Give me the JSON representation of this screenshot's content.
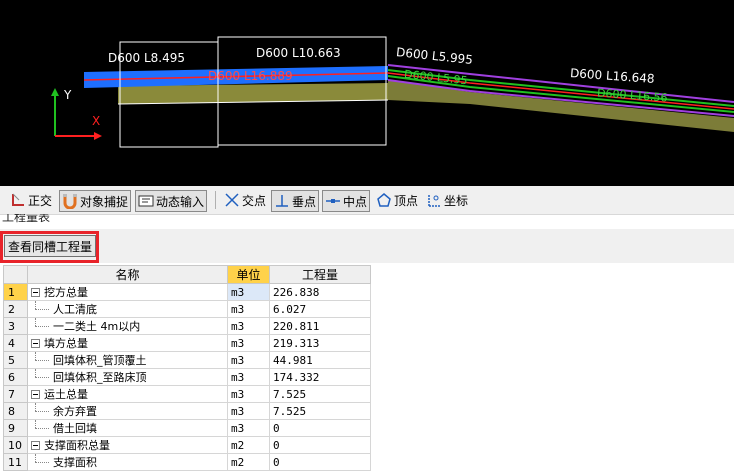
{
  "canvas": {
    "pipe_labels_white": [
      "D600 L8.495",
      "D600 L10.663",
      "D600 L5.995",
      "D600 L16.648"
    ],
    "pipe_labels_red": [
      "D600 L16.889"
    ],
    "pipe_labels_green": [
      "D600 L5.95",
      "D600 L16.56"
    ],
    "axis_y": "Y",
    "axis_x": "X"
  },
  "toolbar": {
    "ortho": "正交",
    "snap": "对象捕捉",
    "dynamic": "动态输入",
    "intersect": "交点",
    "perpendicular": "垂点",
    "midpoint": "中点",
    "vertex": "顶点",
    "coordinate": "坐标"
  },
  "panel": {
    "title": "工程量表",
    "view_button": "查看同槽工程量"
  },
  "grid": {
    "headers": [
      "名称",
      "单位",
      "工程量"
    ],
    "rows": [
      {
        "no": "1",
        "name": "挖方总量",
        "unit": "m3",
        "qty": "226.838",
        "level": 0
      },
      {
        "no": "2",
        "name": "人工清底",
        "unit": "m3",
        "qty": "6.027",
        "level": 1
      },
      {
        "no": "3",
        "name": "一二类土 4m以内",
        "unit": "m3",
        "qty": "220.811",
        "level": 1
      },
      {
        "no": "4",
        "name": "填方总量",
        "unit": "m3",
        "qty": "219.313",
        "level": 0
      },
      {
        "no": "5",
        "name": "回填体积_管顶覆土",
        "unit": "m3",
        "qty": "44.981",
        "level": 1
      },
      {
        "no": "6",
        "name": "回填体积_至路床顶",
        "unit": "m3",
        "qty": "174.332",
        "level": 1
      },
      {
        "no": "7",
        "name": "运土总量",
        "unit": "m3",
        "qty": "7.525",
        "level": 0
      },
      {
        "no": "8",
        "name": "余方弃置",
        "unit": "m3",
        "qty": "7.525",
        "level": 1
      },
      {
        "no": "9",
        "name": "借土回填",
        "unit": "m3",
        "qty": "0",
        "level": 1
      },
      {
        "no": "10",
        "name": "支撑面积总量",
        "unit": "m2",
        "qty": "0",
        "level": 0
      },
      {
        "no": "11",
        "name": "支撑面积",
        "unit": "m2",
        "qty": "0",
        "level": 1
      }
    ]
  },
  "colors": {
    "accent_red": "#e8232a",
    "header_unit": "#ffd24a",
    "pipe_blue": "#1e6fff",
    "trench_olive": "#8a8a3a",
    "pipe_purple": "#a040e0"
  }
}
